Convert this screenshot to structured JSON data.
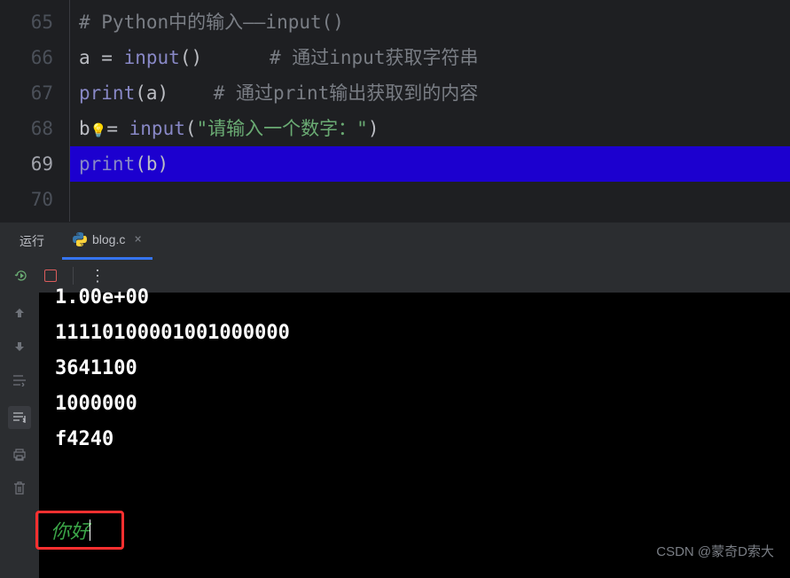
{
  "editor": {
    "lines": [
      {
        "num": "65",
        "active": false,
        "highlighted": false
      },
      {
        "num": "66",
        "active": false,
        "highlighted": false
      },
      {
        "num": "67",
        "active": false,
        "highlighted": false
      },
      {
        "num": "68",
        "active": false,
        "highlighted": false
      },
      {
        "num": "69",
        "active": true,
        "highlighted": true
      },
      {
        "num": "70",
        "active": false,
        "highlighted": false
      }
    ],
    "code": {
      "l65": {
        "comment": "# Python中的输入——input()"
      },
      "l66": {
        "var": "a",
        "op": " = ",
        "func": "input",
        "p1": "()",
        "cmt": "      # 通过input获取字符串"
      },
      "l67": {
        "func": "print",
        "p1": "(",
        "arg": "a",
        "p2": ")",
        "cmt": "    # 通过print输出获取到的内容"
      },
      "l68": {
        "var": "b",
        "op": "= ",
        "func": "input",
        "p1": "(",
        "str": "\"请输入一个数字：\"",
        "p2": ")"
      },
      "l69": {
        "func": "print",
        "p1": "(",
        "arg": "b",
        "p2": ")"
      }
    }
  },
  "panel": {
    "run_label": "运行",
    "tab_name": "blog.c",
    "tab_close": "×"
  },
  "console": {
    "lines": [
      "1.00e+00",
      "11110100001001000000",
      "3641100",
      "1000000",
      "f4240",
      ""
    ],
    "input_text": "你好"
  },
  "watermark": "CSDN @蒙奇D索大"
}
